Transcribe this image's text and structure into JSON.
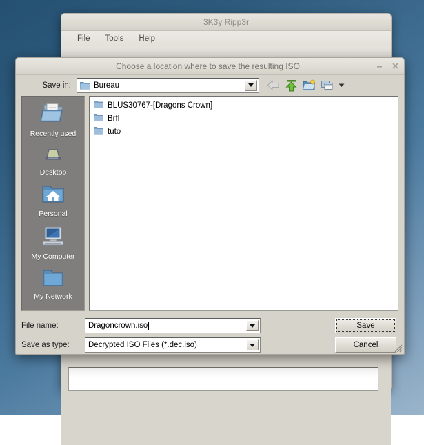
{
  "desktop": {
    "bg_top": "#255072",
    "bg_bottom": "#9ab4ca"
  },
  "background_window": {
    "title": "3K3y Ripp3r",
    "menus": [
      {
        "label": "File"
      },
      {
        "label": "Tools"
      },
      {
        "label": "Help"
      }
    ]
  },
  "dialog": {
    "title": "Choose a location where to save the resulting ISO",
    "window_buttons": [
      {
        "name": "minimize",
        "glyph": "–"
      },
      {
        "name": "close",
        "glyph": "✕"
      }
    ],
    "save_in": {
      "label": "Save in:",
      "value": "Bureau",
      "icon": "folder-icon"
    },
    "toolbar_icons": [
      {
        "name": "back-icon",
        "enabled": false
      },
      {
        "name": "up-one-level-icon",
        "enabled": true
      },
      {
        "name": "new-folder-icon",
        "enabled": true
      },
      {
        "name": "view-mode-icon",
        "enabled": true
      },
      {
        "name": "view-mode-dropdown-icon",
        "enabled": true
      }
    ],
    "sidebar": [
      {
        "label": "Recently used",
        "icon": "recent-documents-icon"
      },
      {
        "label": "Desktop",
        "icon": "desktop-icon"
      },
      {
        "label": "Personal",
        "icon": "home-folder-icon"
      },
      {
        "label": "My Computer",
        "icon": "computer-icon"
      },
      {
        "label": "My Network",
        "icon": "network-folder-icon"
      }
    ],
    "files": [
      {
        "name": "BLUS30767-[Dragons Crown]",
        "type": "folder"
      },
      {
        "name": "Brfl",
        "type": "folder"
      },
      {
        "name": "tuto",
        "type": "folder"
      }
    ],
    "form": {
      "file_name_label": "File name:",
      "file_name_value": "Dragoncrown.iso",
      "save_as_type_label": "Save as type:",
      "save_as_type_value": "Decrypted ISO Files (*.dec.iso)",
      "save_as_type_options": [
        "Decrypted ISO Files (*.dec.iso)"
      ]
    },
    "buttons": {
      "save": "Save",
      "cancel": "Cancel"
    }
  }
}
